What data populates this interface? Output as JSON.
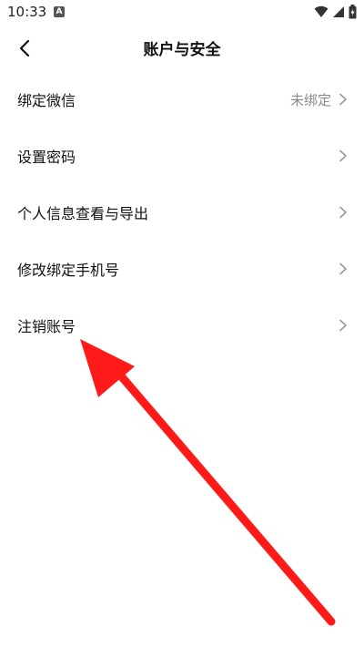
{
  "status_bar": {
    "time": "10:33",
    "notification_icon": "A",
    "icons": [
      "wifi-icon",
      "signal-icon",
      "battery-icon"
    ]
  },
  "header": {
    "title": "账户与安全",
    "back_icon": "back-arrow-icon"
  },
  "menu": {
    "items": [
      {
        "label": "绑定微信",
        "value": "未绑定"
      },
      {
        "label": "设置密码",
        "value": ""
      },
      {
        "label": "个人信息查看与导出",
        "value": ""
      },
      {
        "label": "修改绑定手机号",
        "value": ""
      },
      {
        "label": "注销账号",
        "value": ""
      }
    ]
  },
  "colors": {
    "annotation_arrow": "#ff1a1a",
    "secondary_text": "#8a8a8a",
    "chevron": "#9a9a9a"
  }
}
